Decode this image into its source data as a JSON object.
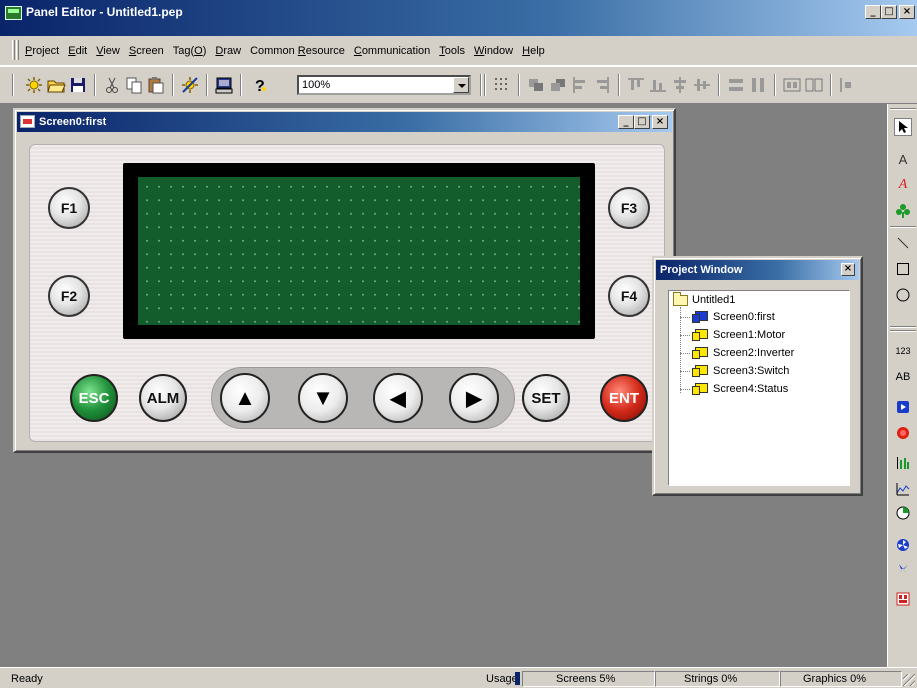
{
  "app": {
    "title": "Panel Editor - Untitled1.pep",
    "window_buttons": {
      "minimize": "_",
      "maximize": "□",
      "close": "×"
    }
  },
  "menu": [
    {
      "pre": "",
      "u": "P",
      "post": "roject"
    },
    {
      "pre": "",
      "u": "E",
      "post": "dit"
    },
    {
      "pre": "",
      "u": "V",
      "post": "iew"
    },
    {
      "pre": "",
      "u": "S",
      "post": "creen"
    },
    {
      "pre": "Tag(",
      "u": "O",
      "post": ")"
    },
    {
      "pre": "",
      "u": "D",
      "post": "raw"
    },
    {
      "pre": "Common ",
      "u": "R",
      "post": "esource"
    },
    {
      "pre": "",
      "u": "C",
      "post": "ommunication"
    },
    {
      "pre": "",
      "u": "T",
      "post": "ools"
    },
    {
      "pre": "",
      "u": "W",
      "post": "indow"
    },
    {
      "pre": "",
      "u": "H",
      "post": "elp"
    }
  ],
  "toolbar": {
    "zoom": "100%"
  },
  "screen_window": {
    "title": "Screen0:first",
    "buttons": {
      "minimize": "_",
      "maximize": "□",
      "close": "×"
    },
    "panel": {
      "function_keys": [
        "F1",
        "F2",
        "F3",
        "F4"
      ],
      "bottom_keys": {
        "esc": "ESC",
        "alm": "ALM",
        "set": "SET",
        "ent": "ENT"
      },
      "arrows": {
        "up": "▲",
        "down": "▼",
        "left": "◀",
        "right": "▶"
      }
    }
  },
  "project_window": {
    "title": "Project Window",
    "close": "×",
    "root": "Untitled1",
    "screens": [
      "Screen0:first",
      "Screen1:Motor",
      "Screen2:Inverter",
      "Screen3:Switch",
      "Screen4:Status"
    ]
  },
  "palette": {
    "text_a": "A",
    "text_a_red": "A",
    "numeric": "123",
    "ab": "AB"
  },
  "status": {
    "ready": "Ready",
    "usage": "Usage",
    "screens": "Screens  5%",
    "strings": "Strings  0%",
    "graphics": "Graphics  0%"
  },
  "colors": {
    "title_active": "#0a246a",
    "lcd": "#135c2c",
    "esc": "#1f8f39",
    "ent": "#d42a1a"
  }
}
